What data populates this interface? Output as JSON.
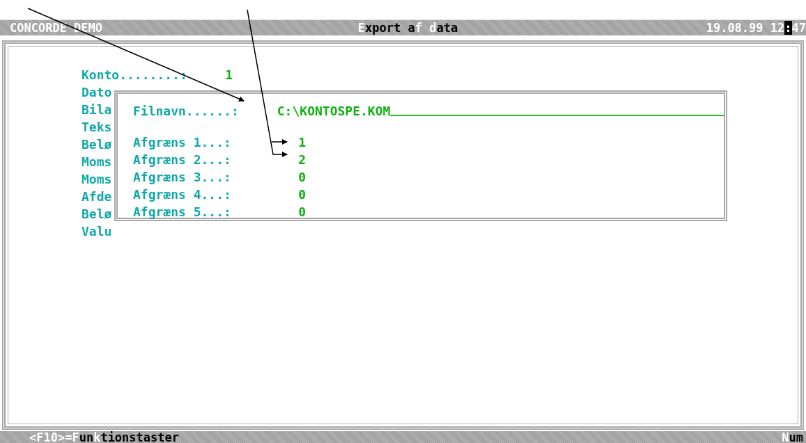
{
  "title_bar": {
    "app_name": "CONCORDE DEMO",
    "title": [
      {
        "text": "E",
        "highlighted": true
      },
      {
        "text": "xport a",
        "highlighted": false
      },
      {
        "text": "f d",
        "highlighted": true
      },
      {
        "text": "ata",
        "highlighted": false
      }
    ],
    "clock": [
      {
        "text": "19.08.99 12",
        "highlighted": false
      },
      {
        "text": ":",
        "highlighted": true
      },
      {
        "text": "47",
        "highlighted": false
      }
    ]
  },
  "main_form": {
    "fields": [
      {
        "label": "Konto........:",
        "value": "1"
      },
      {
        "label": "Dato"
      },
      {
        "label": "Bila"
      },
      {
        "label": "Teks"
      },
      {
        "label": "Belø"
      },
      {
        "label": "Moms"
      },
      {
        "label": "Moms"
      },
      {
        "label": "Afde"
      },
      {
        "label": "Belø"
      },
      {
        "label": "Valu"
      }
    ]
  },
  "export_dialog": {
    "filename": {
      "label": "Filnavn......:",
      "value": "C:\\KONTOSPE.KOM"
    },
    "limits": [
      {
        "label": "Afgræns 1...:",
        "value": "1"
      },
      {
        "label": "Afgræns 2...:",
        "value": "2"
      },
      {
        "label": "Afgræns 3...:",
        "value": "0"
      },
      {
        "label": "Afgræns 4...:",
        "value": "0"
      },
      {
        "label": "Afgræns 5...:",
        "value": "0"
      }
    ]
  },
  "status_bar": {
    "hint": [
      {
        "text": "<F10>=F",
        "highlighted": true
      },
      {
        "text": "un",
        "highlighted": false
      },
      {
        "text": "k",
        "highlighted": true
      },
      {
        "text": "tionstaster",
        "highlighted": false
      }
    ],
    "indicator": [
      {
        "text": "N",
        "highlighted": true
      },
      {
        "text": "um",
        "highlighted": false
      }
    ]
  }
}
